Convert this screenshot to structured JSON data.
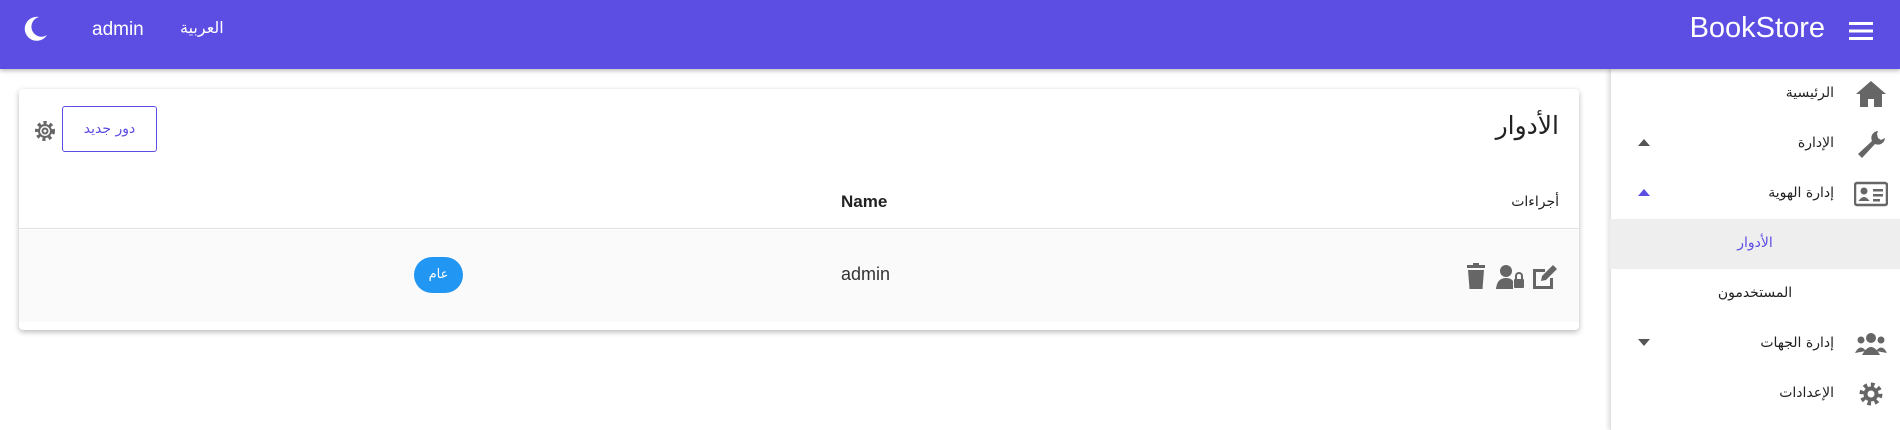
{
  "header": {
    "brand": "BookStore",
    "user": "admin",
    "language": "العربية"
  },
  "sidebar": {
    "items": [
      {
        "label": "الرئيسية",
        "icon": "home-icon"
      },
      {
        "label": "الإدارة",
        "icon": "wrench-icon"
      },
      {
        "label": "إدارة الهوية",
        "icon": "id-card-icon"
      },
      {
        "label": "الأدوار"
      },
      {
        "label": "المستخدمون"
      },
      {
        "label": "إدارة الجهات",
        "icon": "users-icon"
      },
      {
        "label": "الإعدادات",
        "icon": "cog-icon"
      }
    ]
  },
  "page": {
    "title": "الأدوار",
    "new_role_label": "دور جديد",
    "table": {
      "headers": {
        "actions": "أجراءات",
        "name": "Name"
      },
      "rows": [
        {
          "name": "admin",
          "badge": "عام"
        }
      ]
    }
  },
  "colors": {
    "primary": "#5c4de3",
    "badge": "#2196f3"
  }
}
